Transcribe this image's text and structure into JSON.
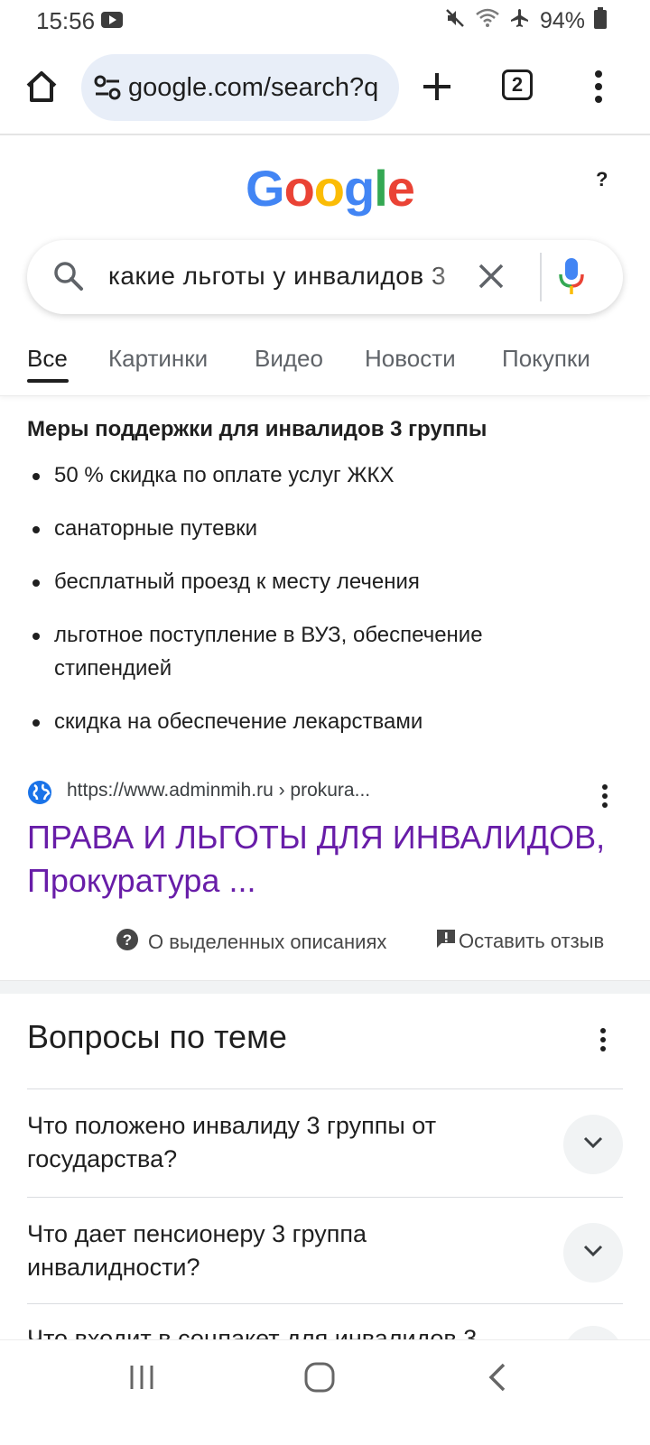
{
  "status": {
    "time": "15:56",
    "battery": "94%"
  },
  "browser": {
    "url": "google.com/search?q",
    "tab_count": "2"
  },
  "google": {
    "logo_letters": [
      {
        "ch": "G",
        "color": "#4285F4"
      },
      {
        "ch": "o",
        "color": "#EA4335"
      },
      {
        "ch": "o",
        "color": "#FBBC05"
      },
      {
        "ch": "g",
        "color": "#4285F4"
      },
      {
        "ch": "l",
        "color": "#34A853"
      },
      {
        "ch": "e",
        "color": "#EA4335"
      }
    ],
    "help_label": "?"
  },
  "search": {
    "query": "какие льготы у инвалидов 3"
  },
  "tabs": [
    {
      "label": "Все",
      "active": true
    },
    {
      "label": "Картинки",
      "active": false
    },
    {
      "label": "Видео",
      "active": false
    },
    {
      "label": "Новости",
      "active": false
    },
    {
      "label": "Покупки",
      "active": false
    }
  ],
  "snippet": {
    "title": "Меры поддержки для инвалидов 3 группы",
    "items": [
      "50 % скидка по оплате услуг ЖКХ",
      "санаторные путевки",
      "бесплатный проезд к месту лечения",
      "льготное поступление в ВУЗ, обеспечение стипендией",
      "скидка на обеспечение лекарствами"
    ]
  },
  "result": {
    "url": "https://www.adminmih.ru › prokura...",
    "title": "ПРАВА И ЛЬГОТЫ ДЛЯ ИНВАЛИДОВ, Прокуратура ..."
  },
  "featured_footer": {
    "about_label": "О выделенных описаниях",
    "feedback_label": "Оставить отзыв"
  },
  "paa": {
    "title": "Вопросы по теме",
    "questions": [
      "Что положено инвалиду 3 группы от государства?",
      "Что дает пенсионеру 3 группа инвалидности?",
      "Что входит в соцпакет для инвалидов 3"
    ]
  },
  "colors": {
    "link_visited": "#681da8",
    "mic_blue": "#4285F4",
    "mic_red": "#EA4335",
    "mic_yellow": "#FBBC05",
    "mic_green": "#34A853"
  }
}
